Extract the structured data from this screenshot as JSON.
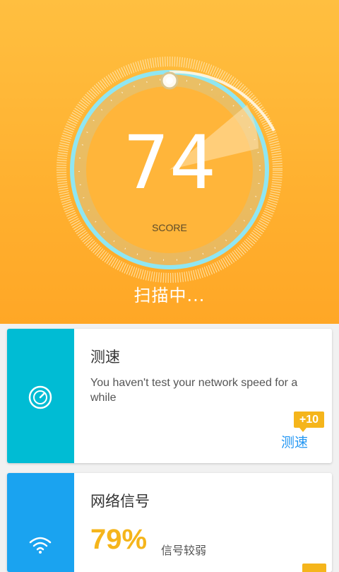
{
  "score": {
    "value": "74",
    "label": "SCORE",
    "status": "扫描中..."
  },
  "cards": [
    {
      "title": "测速",
      "description": "You haven't test your network speed for a while",
      "bonus": "+10",
      "action": "测速",
      "icon": "speedometer-icon",
      "color": "#00bcd4"
    },
    {
      "title": "网络信号",
      "percent": "79%",
      "description": "信号较弱",
      "icon": "wifi-icon",
      "color": "#1aa3f0"
    }
  ],
  "colors": {
    "hero": "#ffb02f",
    "accent": "#f5b51b",
    "link": "#2196f3"
  }
}
